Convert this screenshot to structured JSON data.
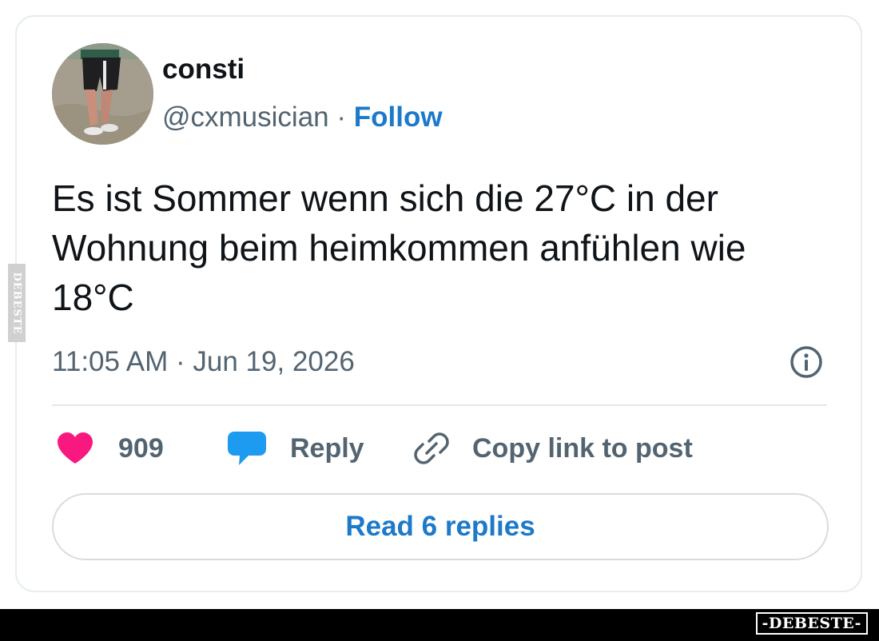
{
  "tweet": {
    "display_name": "consti",
    "handle": "@cxmusician",
    "separator": "·",
    "follow_label": "Follow",
    "text": "Es ist Sommer wenn sich die 27°C in der Wohnung beim heimkommen anfühlen wie 18°C",
    "timestamp": "11:05 AM · Jun 19, 2026"
  },
  "actions": {
    "like_count": "909",
    "reply_label": "Reply",
    "copy_link_label": "Copy link to post"
  },
  "read_replies_label": "Read 6 replies",
  "watermark": {
    "side_text": "DEBESTE",
    "bottom_text": "-DEBESTE-"
  },
  "icons": {
    "heart": "heart-icon",
    "reply": "speech-bubble-icon",
    "copy_link": "link-icon",
    "info": "info-icon"
  },
  "colors": {
    "heart": "#f91880",
    "reply_bubble": "#1d9bf0",
    "link_blue": "#1d79c9",
    "secondary_text": "#536471"
  }
}
